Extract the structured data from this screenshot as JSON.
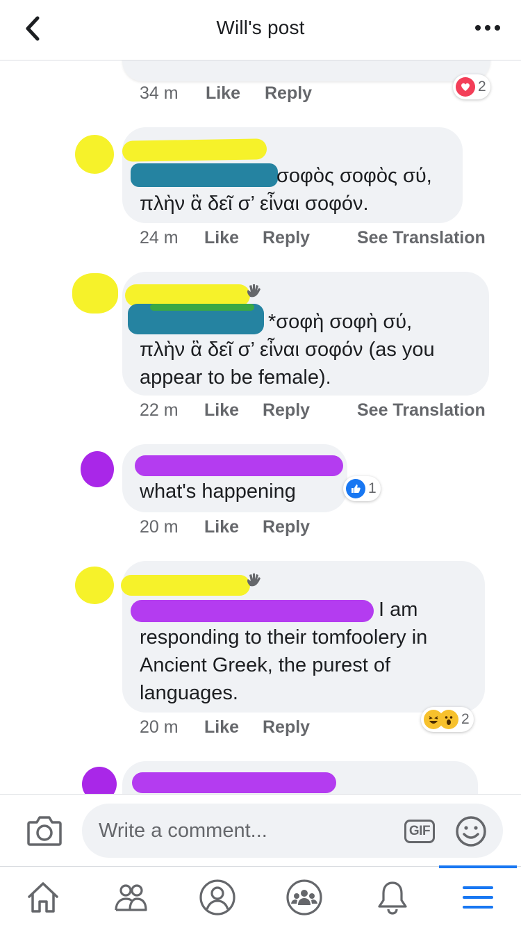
{
  "header": {
    "title": "Will's post"
  },
  "comments": [
    {
      "time": "34 m",
      "like": "Like",
      "reply": "Reply",
      "reaction_count": "2"
    },
    {
      "text_line1": "σοφὸς σοφὸς σύ,",
      "text_line2": "πλὴν ἃ δεῖ σ’ εἶναι σοφόν.",
      "time": "24 m",
      "like": "Like",
      "reply": "Reply",
      "see_translation": "See Translation"
    },
    {
      "text_line1": "*σοφὴ σοφὴ σύ,",
      "text_line2": "πλὴν ἃ δεῖ σ’ εἶναι σοφόν (as you",
      "text_line3": "appear to be female).",
      "time": "22 m",
      "like": "Like",
      "reply": "Reply",
      "see_translation": "See Translation"
    },
    {
      "text_line1": "what's happening",
      "time": "20 m",
      "like": "Like",
      "reply": "Reply",
      "reaction_count": "1"
    },
    {
      "text_line1": "I am",
      "text_line2": "responding to their tomfoolery in",
      "text_line3": "Ancient Greek, the purest of",
      "text_line4": "languages.",
      "time": "20 m",
      "like": "Like",
      "reply": "Reply",
      "reaction_count": "2"
    }
  ],
  "composer": {
    "placeholder": "Write a comment...",
    "gif_label": "GIF"
  },
  "icons": {
    "back": "chevron-left-icon",
    "more": "more-horizontal-icon",
    "camera": "camera-icon",
    "gif": "gif-icon",
    "emoji": "smiley-icon",
    "home": "home-icon",
    "friends": "friends-icon",
    "profile": "profile-icon",
    "groups": "groups-icon",
    "notifications": "bell-icon",
    "menu": "menu-icon"
  },
  "colors": {
    "accent": "#1877f2",
    "bubble": "#f0f2f5",
    "meta": "#65676b",
    "redact_yellow": "#f6f22a",
    "redact_teal": "#2583a1",
    "redact_purple": "#b43cf0",
    "love": "#f33e58"
  }
}
